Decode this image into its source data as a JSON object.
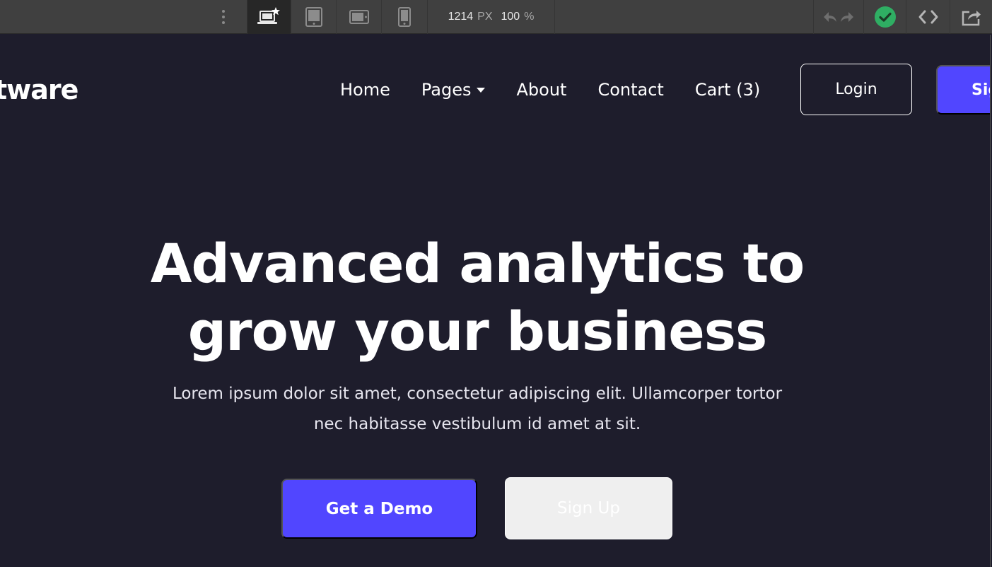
{
  "toolbar": {
    "breakpoints": [
      {
        "name": "desktop-base",
        "icon": "laptop-star-icon",
        "active": true
      },
      {
        "name": "tablet",
        "icon": "tablet-icon",
        "active": false
      },
      {
        "name": "mobile-landscape",
        "icon": "phone-landscape-icon",
        "active": false
      },
      {
        "name": "mobile-portrait",
        "icon": "phone-portrait-icon",
        "active": false
      }
    ],
    "width_value": "1214",
    "width_unit": "PX",
    "zoom_value": "100",
    "zoom_unit": "%",
    "status_color": "#2fae63"
  },
  "site": {
    "brand": "tware",
    "nav": {
      "home": "Home",
      "pages": "Pages",
      "about": "About",
      "contact": "Contact",
      "cart": "Cart (3)"
    },
    "login_label": "Login",
    "signup_label": "Sig"
  },
  "hero": {
    "title_line1": "Advanced analytics to",
    "title_line2": "grow your business",
    "subtitle_line1": "Lorem ipsum dolor sit amet, consectetur adipiscing elit. Ullamcorper tortor",
    "subtitle_line2": "nec habitasse vestibulum id amet at sit.",
    "demo_label": "Get a Demo",
    "signup_label": "Sign Up"
  },
  "colors": {
    "background": "#1e1d2c",
    "accent": "#5146ff",
    "toolbar": "#404040"
  }
}
